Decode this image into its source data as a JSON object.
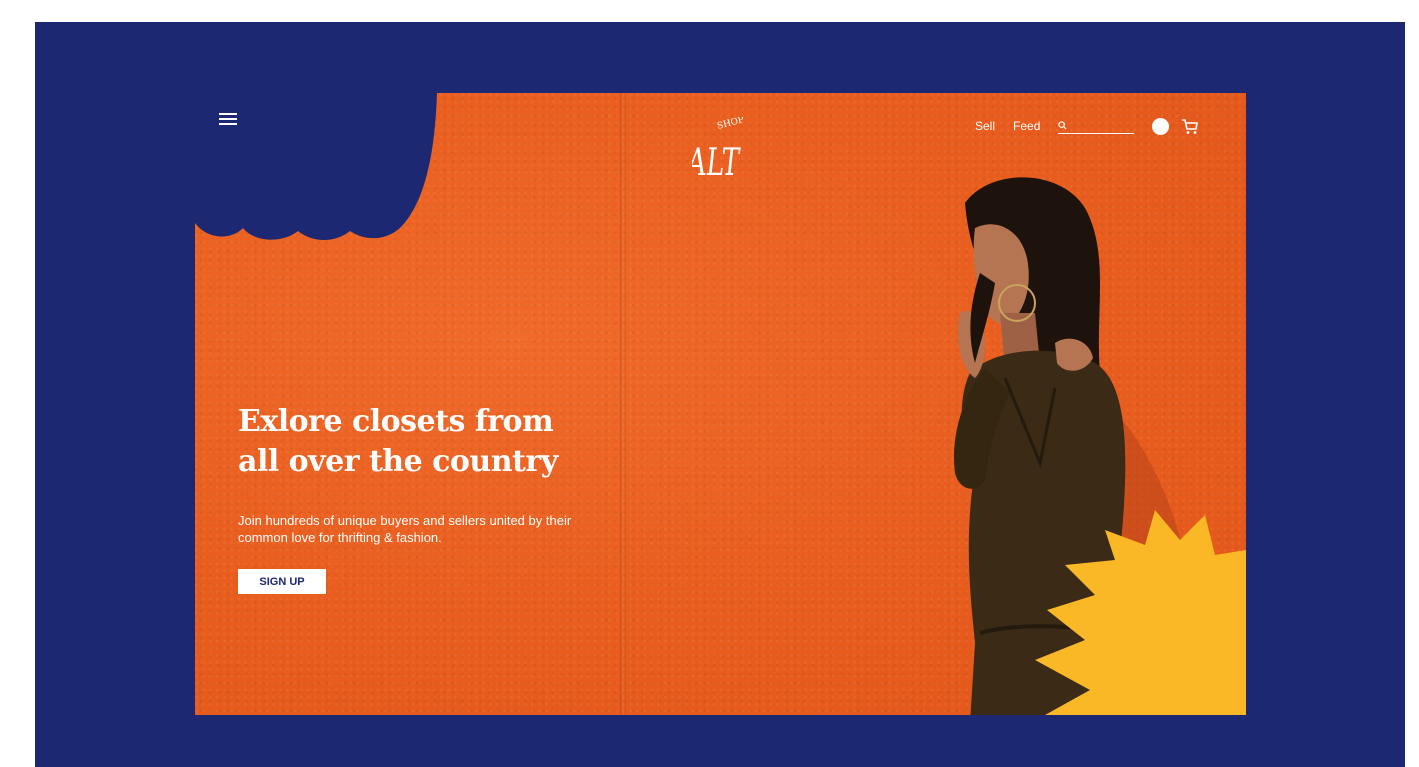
{
  "brand": {
    "logo_text": "ALT",
    "logo_small_text": "SHOP"
  },
  "nav": {
    "sell": "Sell",
    "feed": "Feed",
    "search_placeholder": ""
  },
  "hero": {
    "headline": "Exlore closets from all over the country",
    "subtext": "Join hundreds of unique buyers and sellers united by their common love for thrifting & fashion.",
    "cta": "SIGN UP"
  },
  "icons": {
    "menu": "menu-icon",
    "search": "search-icon",
    "avatar": "avatar",
    "cart": "cart-icon"
  },
  "colors": {
    "background": "#1c2872",
    "hero_orange": "#ea5f1f",
    "accent_yellow": "#fbb826",
    "text": "#ffffff"
  }
}
